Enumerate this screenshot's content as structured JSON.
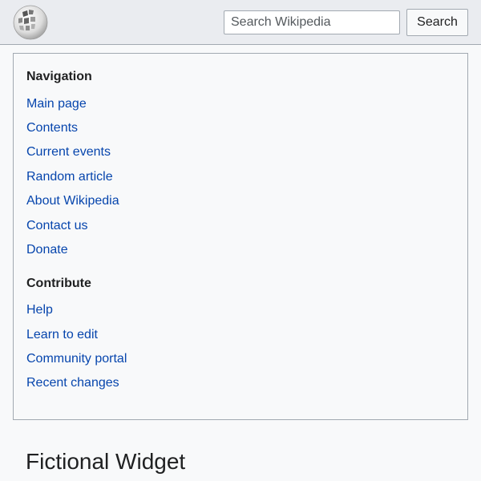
{
  "header": {
    "logo_icon": "wikipedia-globe-icon",
    "search_placeholder": "Search Wikipedia",
    "search_value": "",
    "search_button_label": "Search"
  },
  "menu": {
    "sections": [
      {
        "heading": "Navigation",
        "items": [
          "Main page",
          "Contents",
          "Current events",
          "Random article",
          "About Wikipedia",
          "Contact us",
          "Donate"
        ]
      },
      {
        "heading": "Contribute",
        "items": [
          "Help",
          "Learn to edit",
          "Community portal",
          "Recent changes"
        ]
      }
    ]
  },
  "page": {
    "title": "Fictional Widget"
  },
  "colors": {
    "link": "#0645ad",
    "header_bg": "#eaecf0",
    "border": "#a2a9b1"
  }
}
